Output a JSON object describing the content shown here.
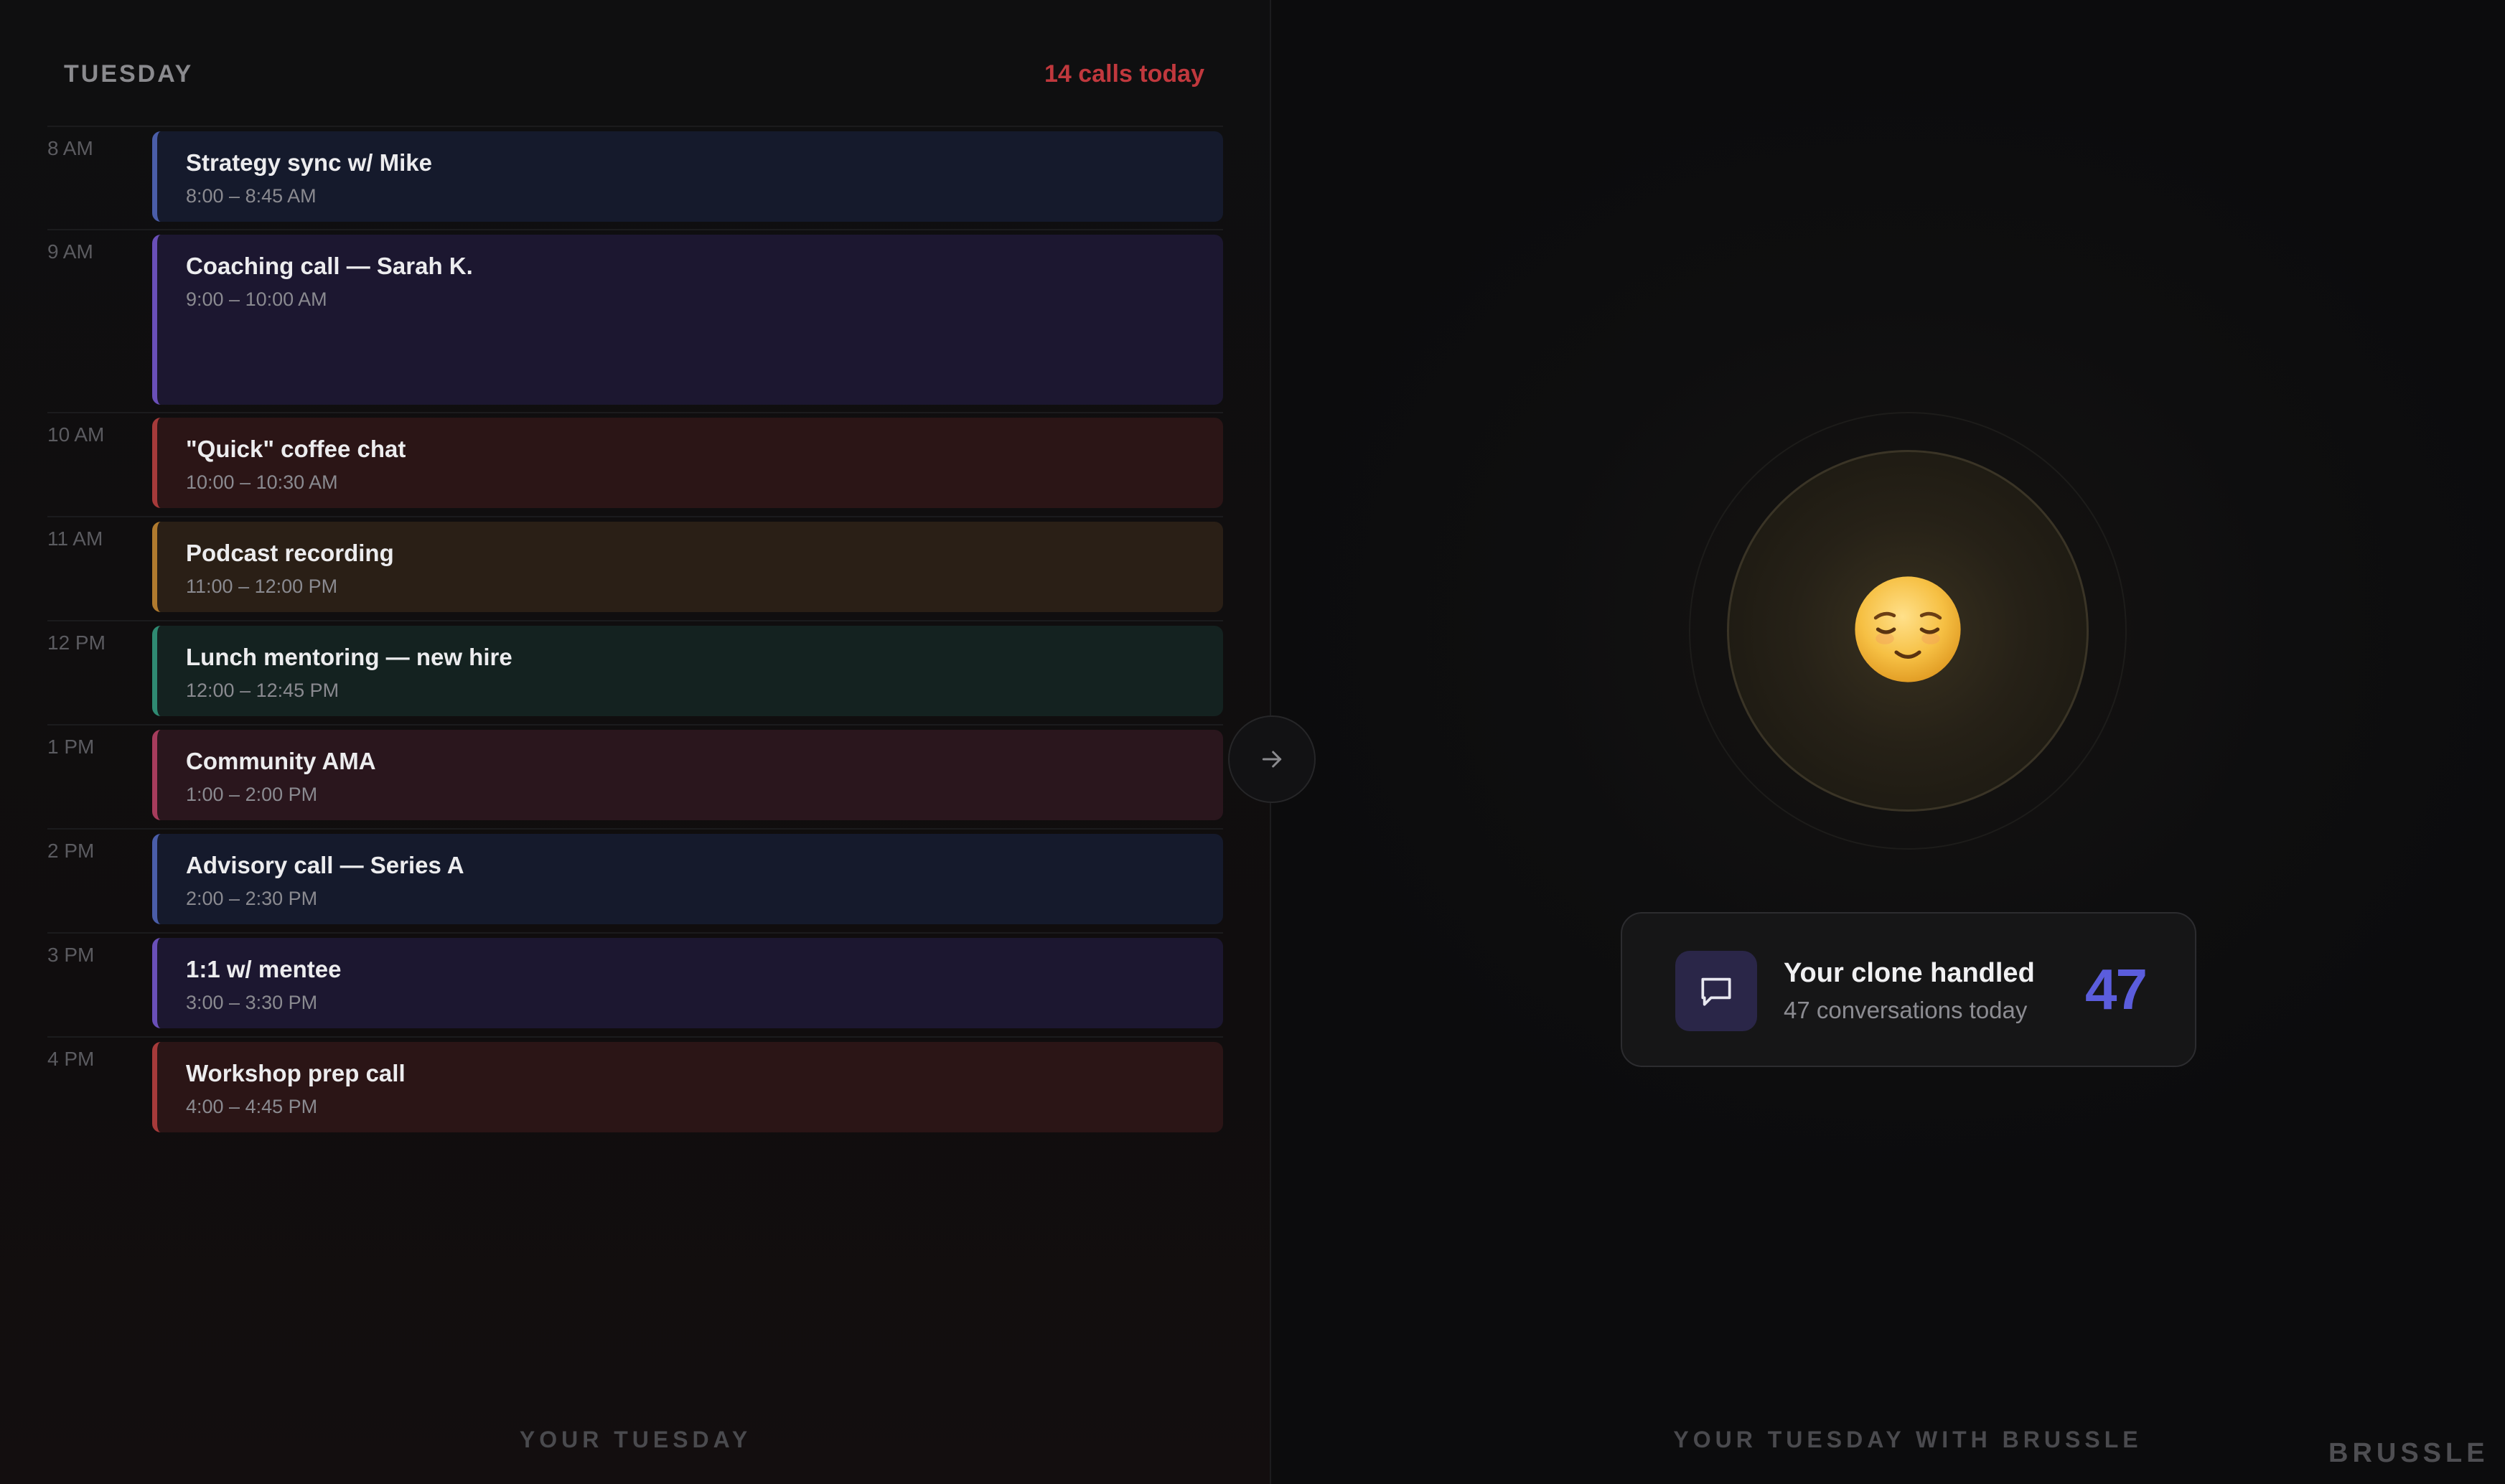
{
  "schedule": {
    "day": "TUESDAY",
    "calls_count": "14 calls today",
    "footer": "YOUR TUESDAY",
    "rows": [
      {
        "time": "8 AM",
        "title": "Strategy sync w/ Mike",
        "range": "8:00 – 8:45 AM",
        "color": "blue"
      },
      {
        "time": "9 AM",
        "title": "Coaching call — Sarah K.",
        "range": "9:00 – 10:00 AM",
        "color": "purple"
      },
      {
        "time": "10 AM",
        "title": "\"Quick\" coffee chat",
        "range": "10:00 – 10:30 AM",
        "color": "red"
      },
      {
        "time": "11 AM",
        "title": "Podcast recording",
        "range": "11:00 – 12:00 PM",
        "color": "amber"
      },
      {
        "time": "12 PM",
        "title": "Lunch mentoring — new hire",
        "range": "12:00 – 12:45 PM",
        "color": "green"
      },
      {
        "time": "1 PM",
        "title": "Community AMA",
        "range": "1:00 – 2:00 PM",
        "color": "rose"
      },
      {
        "time": "2 PM",
        "title": "Advisory call — Series A",
        "range": "2:00 – 2:30 PM",
        "color": "blue"
      },
      {
        "time": "3 PM",
        "title": "1:1 w/ mentee",
        "range": "3:00 – 3:30 PM",
        "color": "purple"
      },
      {
        "time": "4 PM",
        "title": "Workshop prep call",
        "range": "4:00 – 4:45 PM",
        "color": "red"
      }
    ]
  },
  "compare_button": {
    "icon": "arrow-right-icon"
  },
  "brussle": {
    "avatar_icon": "relieved-face-emoji",
    "card": {
      "icon": "chat-bubble-icon",
      "title": "Your clone handled",
      "subtitle": "47 conversations today",
      "count": "47"
    },
    "footer": "YOUR TUESDAY WITH BRUSSLE",
    "brand": "BRUSSLE"
  },
  "colors": {
    "calls_accent": "#c0383d",
    "count_accent": "#5b5ddc"
  }
}
